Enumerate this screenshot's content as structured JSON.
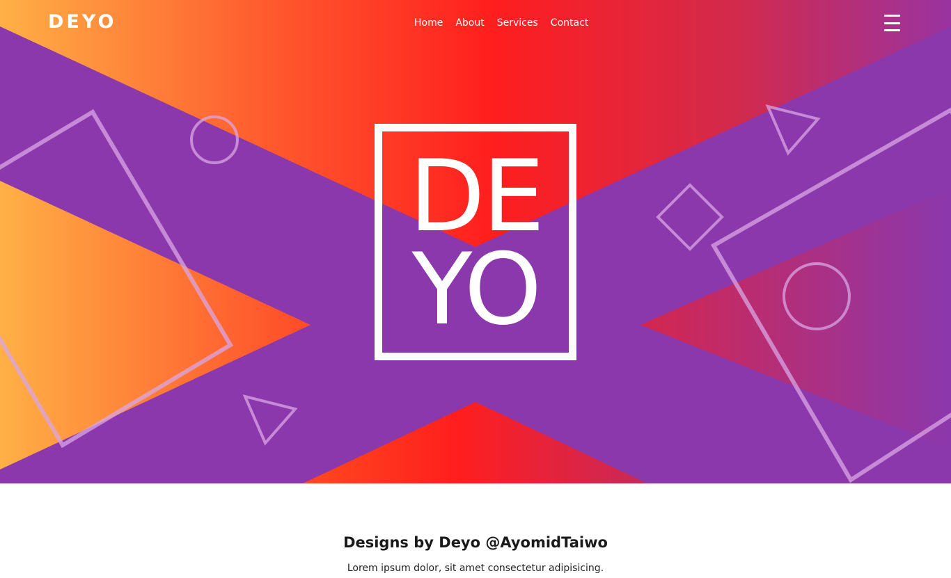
{
  "header": {
    "logo_text": "DEYO",
    "nav": [
      {
        "label": "Home"
      },
      {
        "label": "About"
      },
      {
        "label": "Services"
      },
      {
        "label": "Contact"
      }
    ],
    "menu_icon": "hamburger-menu-icon"
  },
  "hero": {
    "logo_line1": "DE",
    "logo_line2": "YO",
    "colors": {
      "purple": "#8B38AD",
      "red": "#FF1E1E",
      "orange": "#FFB046",
      "outline": "#D9A6E4"
    }
  },
  "section": {
    "title": "Designs by Deyo @AyomidTaiwo",
    "text": "Lorem ipsum dolor, sit amet consectetur adipisicing."
  }
}
